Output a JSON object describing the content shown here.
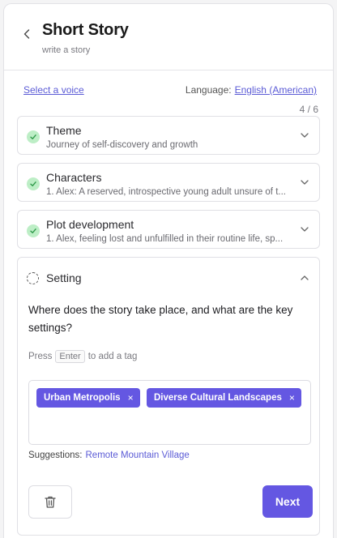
{
  "header": {
    "title": "Short Story",
    "subtitle": "write a story"
  },
  "voice": {
    "select_label": "Select a voice",
    "language_label": "Language:",
    "language_value": "English (American)"
  },
  "progress": "4 / 6",
  "steps": [
    {
      "title": "Theme",
      "description": "Journey of self-discovery and growth"
    },
    {
      "title": "Characters",
      "description": "1. Alex: A reserved, introspective young adult unsure of t..."
    },
    {
      "title": "Plot development",
      "description": "1. Alex, feeling lost and unfulfilled in their routine life, sp..."
    }
  ],
  "setting": {
    "title": "Setting",
    "question": "Where does the story take place, and what are the key settings?",
    "hint_press": "Press",
    "hint_key": "Enter",
    "hint_rest": "to add a tag",
    "tags": [
      "Urban Metropolis",
      "Diverse Cultural Landscapes"
    ],
    "tag_remove": "×",
    "suggestions_label": "Suggestions:",
    "suggestions": [
      "Remote Mountain Village"
    ],
    "next_label": "Next"
  },
  "colors": {
    "accent": "#6457e2",
    "link": "#5b5bd6",
    "check_bg": "#bdeec6",
    "check_mark": "#2f9a4a"
  },
  "icons": {
    "back": "chevron-left-icon",
    "step_done": "check-circle-icon",
    "collapsed": "chevron-down-icon",
    "expanded": "chevron-up-icon",
    "pending": "dashed-circle-icon",
    "delete": "trash-icon"
  }
}
